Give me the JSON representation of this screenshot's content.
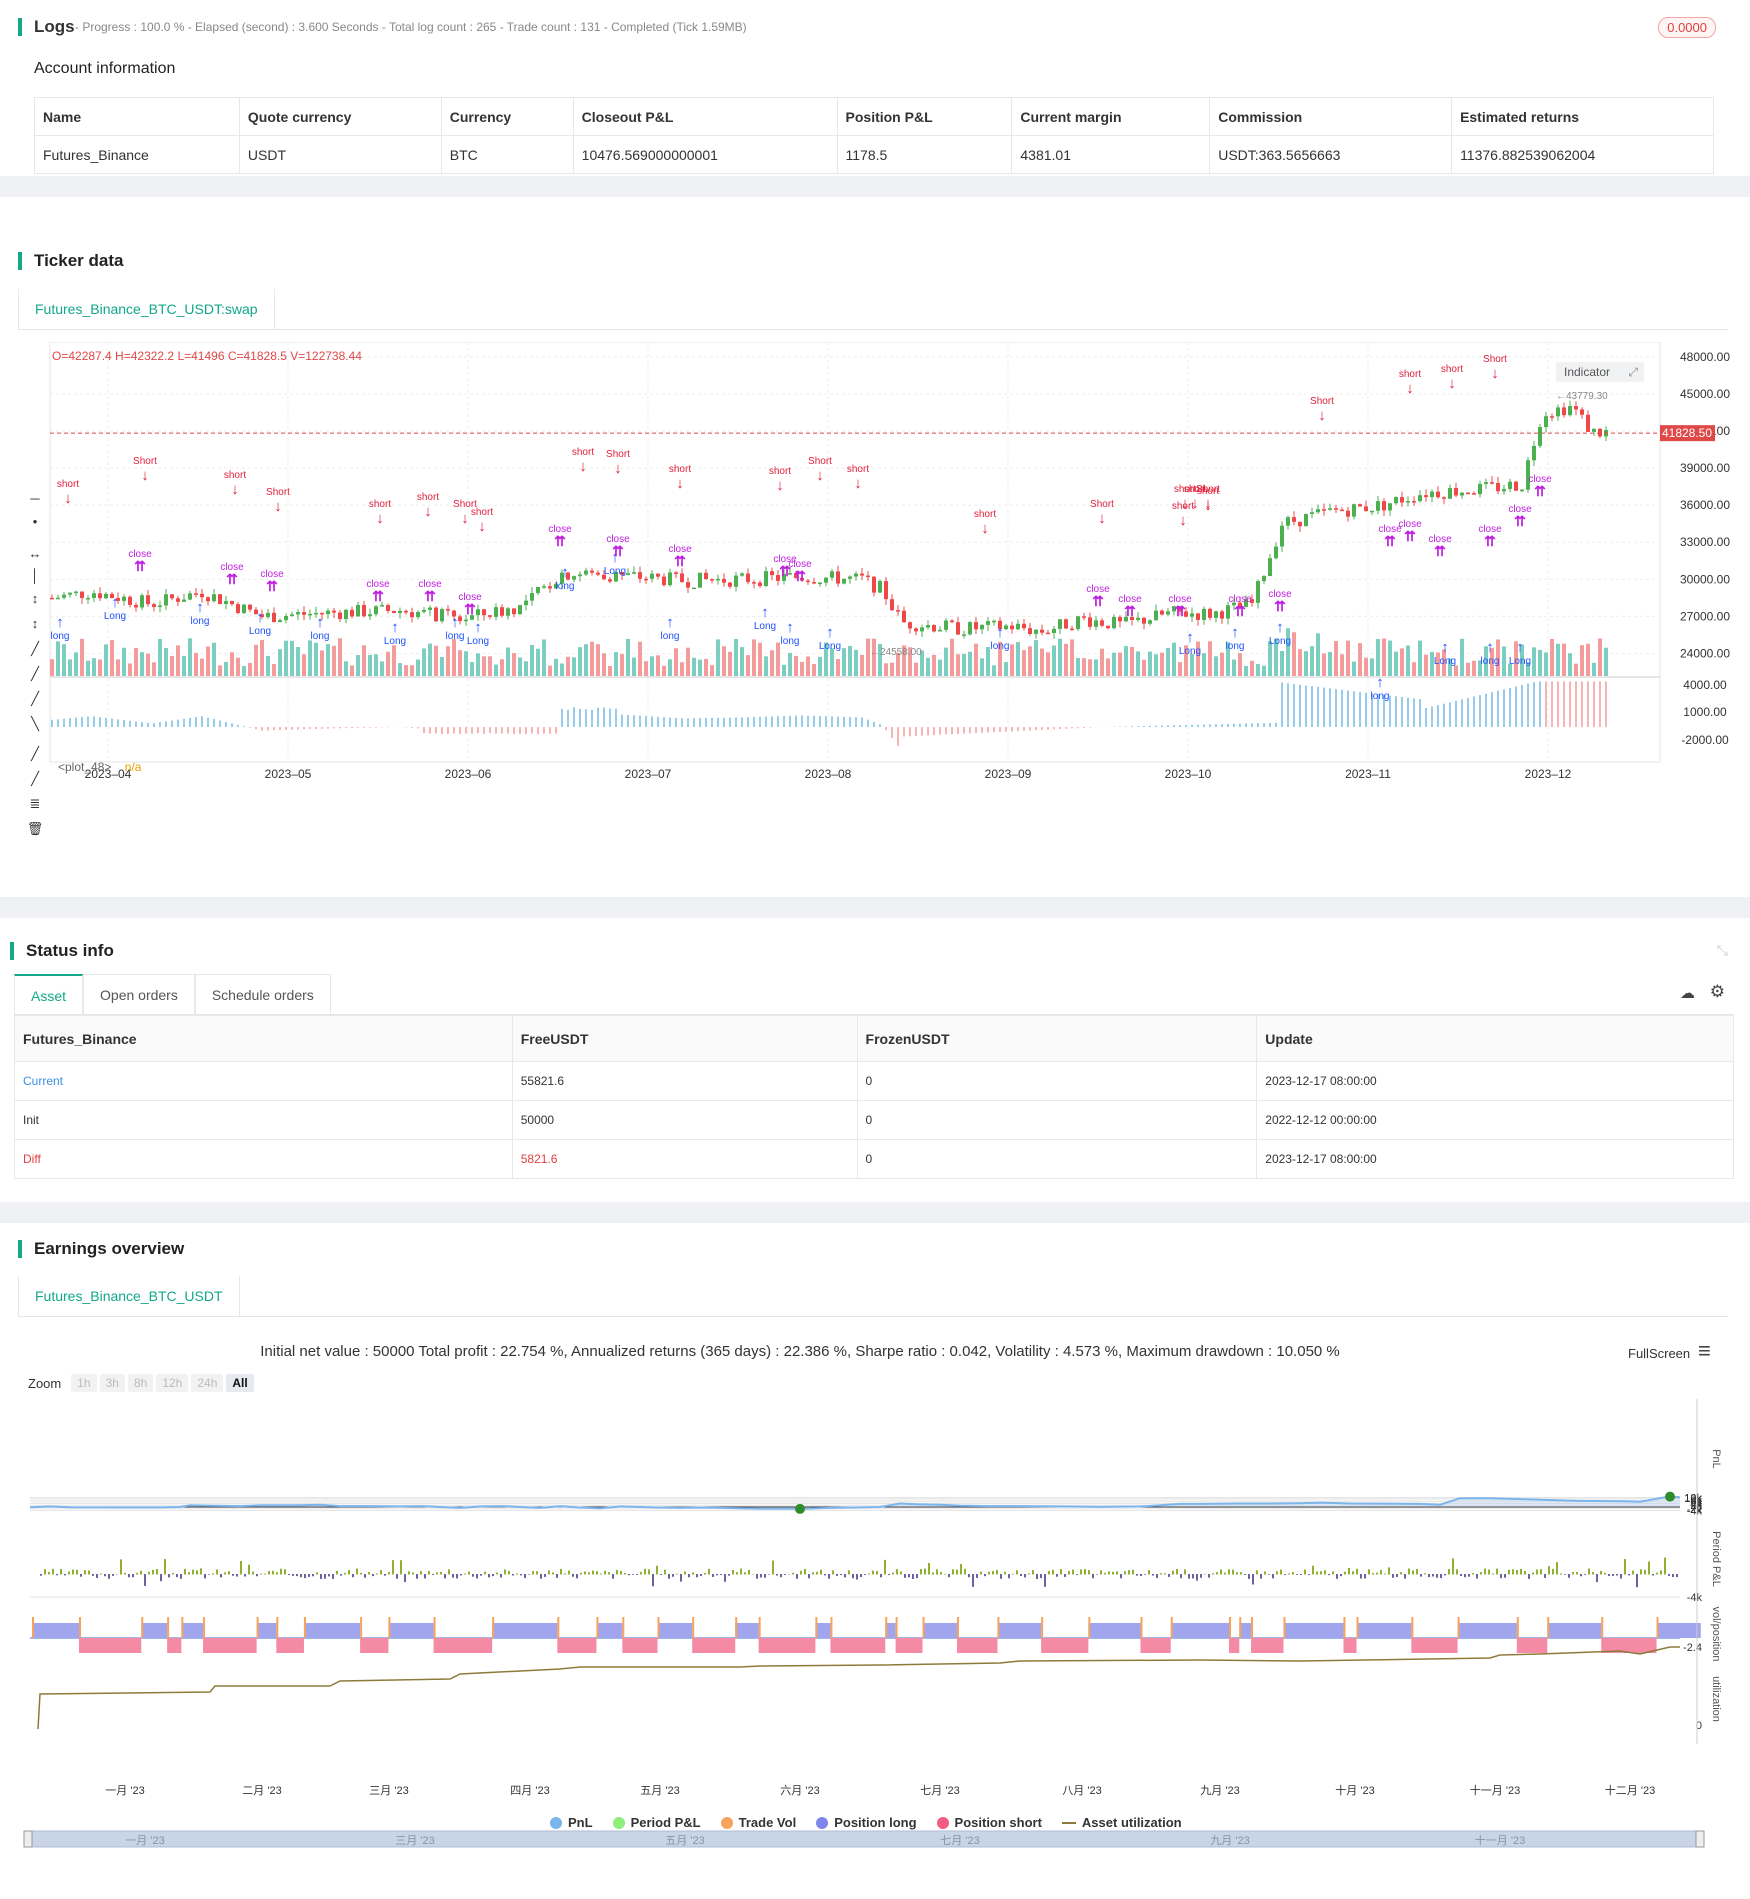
{
  "logs": {
    "title": "Logs",
    "progress": "- Progress : 100.0 % - Elapsed (second) : 3.600  Seconds - Total log count : 265 - Trade count : 131 - Completed (Tick 1.59MB)",
    "badge": "0.0000"
  },
  "account": {
    "title": "Account information",
    "headers": [
      "Name",
      "Quote currency",
      "Currency",
      "Closeout P&L",
      "Position P&L",
      "Current margin",
      "Commission",
      "Estimated returns"
    ],
    "row": [
      "Futures_Binance",
      "USDT",
      "BTC",
      "10476.569000000001",
      "1178.5",
      "4381.01",
      "USDT:363.5656663",
      "11376.882539062004"
    ]
  },
  "ticker": {
    "title": "Ticker data",
    "tab": "Futures_Binance_BTC_USDT:swap",
    "ohlc": "O=42287.4 H=42322.2 L=41496 C=41828.5 V=122738.44",
    "indicator": "Indicator",
    "price_tag": "41828.50",
    "plot_label": "<plot_48>",
    "plot_value": "n/a",
    "high_mark": "43779.30",
    "low_mark": "24558.00",
    "y_ticks": [
      "48000.00",
      "45000.00",
      "42000.00",
      "39000.00",
      "36000.00",
      "33000.00",
      "30000.00",
      "27000.00",
      "24000.00"
    ],
    "sub_ticks": [
      "4000.00",
      "1000.00",
      "-2000.00"
    ],
    "x_ticks": [
      "2023–04",
      "2023–05",
      "2023–06",
      "2023–07",
      "2023–08",
      "2023–09",
      "2023–10",
      "2023–11",
      "2023–12"
    ],
    "marker_labels": {
      "short": "short",
      "Short": "Short",
      "close": "close",
      "long": "long",
      "Long": "Long",
      "one": "1"
    }
  },
  "status": {
    "title": "Status info",
    "tabs": [
      "Asset",
      "Open orders",
      "Schedule orders"
    ],
    "headers": [
      "Futures_Binance",
      "FreeUSDT",
      "FrozenUSDT",
      "Update"
    ],
    "rows": [
      [
        "Current",
        "55821.6",
        "0",
        "2023-12-17 08:00:00"
      ],
      [
        "Init",
        "50000",
        "0",
        "2022-12-12 00:00:00"
      ],
      [
        "Diff",
        "5821.6",
        "0",
        "2023-12-17 08:00:00"
      ]
    ]
  },
  "earnings": {
    "title": "Earnings overview",
    "tab": "Futures_Binance_BTC_USDT",
    "summary": "Initial net value : 50000 Total profit : 22.754 %, Annualized returns (365 days) : 22.386 %, Sharpe ratio : 0.042, Volatility : 4.573 %, Maximum drawdown : 10.050 %",
    "fullscreen": "FullScreen",
    "zoom_label": "Zoom",
    "zoom_buttons": [
      "1h",
      "3h",
      "8h",
      "12h",
      "24h",
      "All"
    ],
    "pnl_ticks": [
      "12k",
      "10k",
      "8k",
      "6k",
      "4k",
      "2k",
      "0",
      "-2k",
      "-4k"
    ],
    "period_ticks": [
      "-4k"
    ],
    "pos_ticks": [
      "-2.4"
    ],
    "util_ticks": [
      "0"
    ],
    "axis_titles": [
      "PnL",
      "Period P&L",
      "vol/position",
      "utilization"
    ],
    "x_ticks": [
      "一月 '23",
      "二月 '23",
      "三月 '23",
      "四月 '23",
      "五月 '23",
      "六月 '23",
      "七月 '23",
      "八月 '23",
      "九月 '23",
      "十月 '23",
      "十一月 '23",
      "十二月 '23"
    ],
    "nav_ticks": [
      "一月 '23",
      "三月 '23",
      "五月 '23",
      "七月 '23",
      "九月 '23",
      "十一月 '23"
    ],
    "legend": [
      {
        "name": "PnL",
        "color": "#7cb5ec"
      },
      {
        "name": "Period P&L",
        "color": "#90ed7d"
      },
      {
        "name": "Trade Vol",
        "color": "#f7a35c"
      },
      {
        "name": "Position long",
        "color": "#8085e9"
      },
      {
        "name": "Position short",
        "color": "#f15c80"
      },
      {
        "name": "Asset utilization",
        "color": "#8d7a3a"
      }
    ]
  }
}
